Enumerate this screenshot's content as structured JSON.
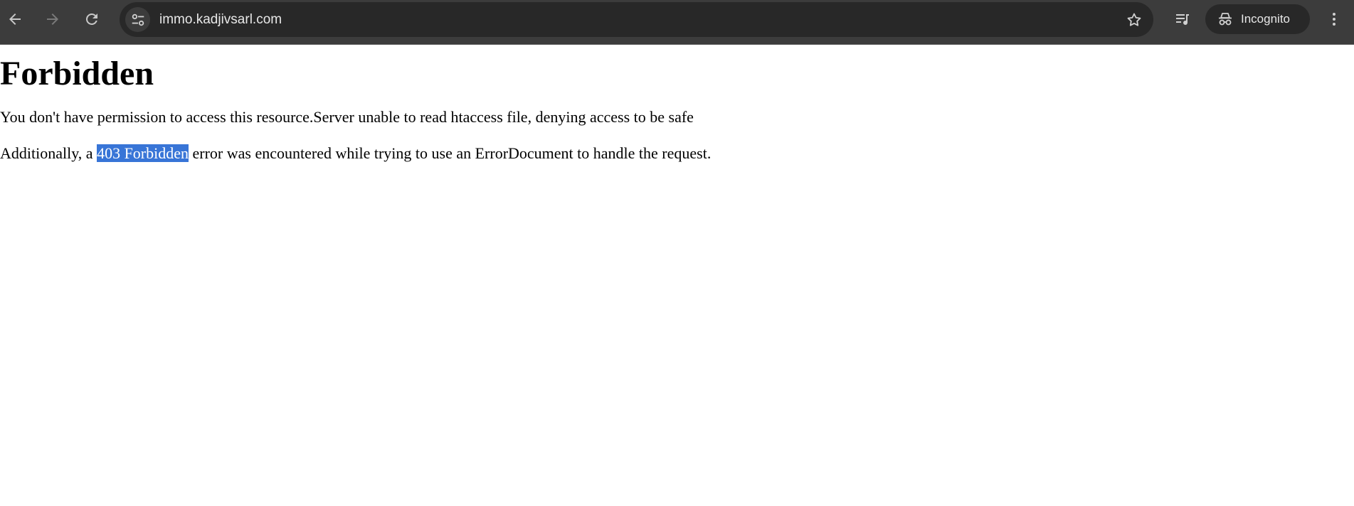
{
  "browser": {
    "url": "immo.kadjivsarl.com",
    "profile_label": "Incognito",
    "icons": {
      "back": "arrow-left-icon",
      "forward": "arrow-right-icon",
      "reload": "reload-icon",
      "site_info": "tune-icon",
      "bookmark": "star-icon",
      "media": "playlist-music-icon",
      "incognito": "incognito-icon",
      "menu": "kebab-menu-icon"
    }
  },
  "page": {
    "heading": "Forbidden",
    "paragraph1": "You don't have permission to access this resource.Server unable to read htaccess file, denying access to be safe",
    "paragraph2": {
      "before": "Additionally, a ",
      "selected": "403 Forbidden",
      "after": " error was encountered while trying to use an ErrorDocument to handle the request."
    }
  },
  "colors": {
    "toolbar_bg": "#3c3c3c",
    "omnibox_bg": "#282828",
    "selection_bg": "#3875d7"
  }
}
